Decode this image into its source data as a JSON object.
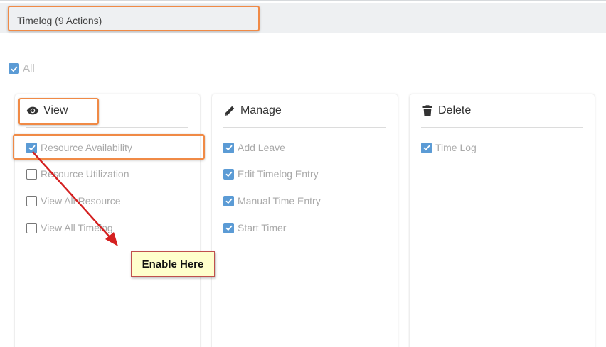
{
  "header": {
    "title": "Timelog  (9 Actions)"
  },
  "all": {
    "label": "All",
    "checked": true
  },
  "cards": [
    {
      "title": "View",
      "icon": "eye-icon",
      "items": [
        {
          "label": "Resource Availability",
          "checked": true
        },
        {
          "label": "Resource Utilization",
          "checked": false
        },
        {
          "label": "View All Resource",
          "checked": false
        },
        {
          "label": "View All Timelog",
          "checked": false
        }
      ]
    },
    {
      "title": "Manage",
      "icon": "pencil-icon",
      "items": [
        {
          "label": "Add Leave",
          "checked": true
        },
        {
          "label": "Edit Timelog Entry",
          "checked": true
        },
        {
          "label": "Manual Time Entry",
          "checked": true
        },
        {
          "label": "Start Timer",
          "checked": true
        }
      ]
    },
    {
      "title": "Delete",
      "icon": "trash-icon",
      "items": [
        {
          "label": "Time Log",
          "checked": true
        }
      ]
    }
  ],
  "annotation": {
    "text": "Enable Here"
  },
  "colors": {
    "accent": "#5b9bd5",
    "highlight": "#f08a46",
    "arrow": "#d42020",
    "callout_bg": "#ffffcc"
  }
}
